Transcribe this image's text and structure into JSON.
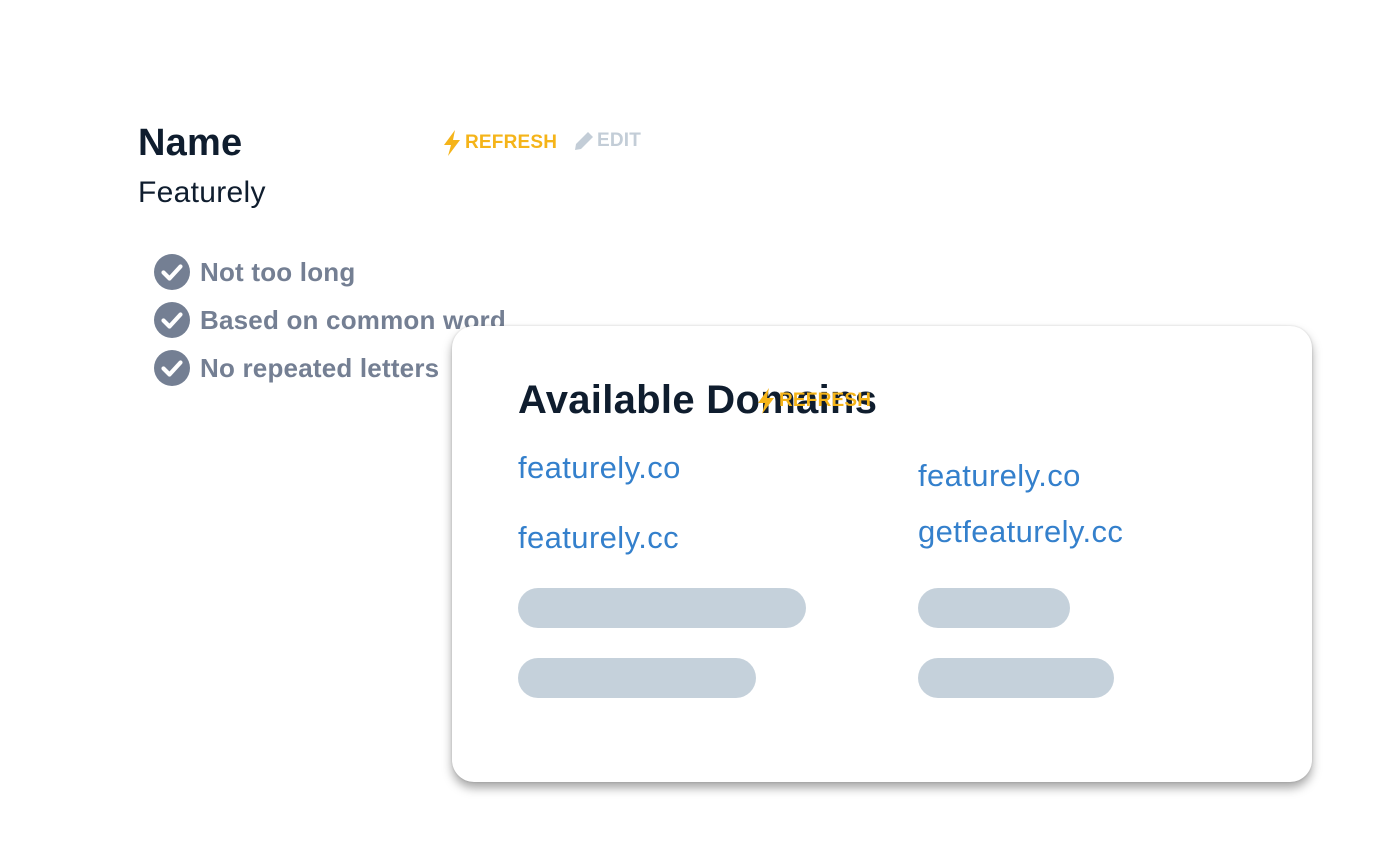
{
  "name_section": {
    "title": "Name",
    "refresh_label": "REFRESH",
    "edit_label": "EDIT",
    "value": "Featurely",
    "criteria": [
      {
        "label": "Not too long",
        "icon": "check-circle-icon"
      },
      {
        "label": "Based on common word",
        "icon": "check-circle-icon"
      },
      {
        "label": "No repeated letters",
        "icon": "check-circle-icon"
      }
    ]
  },
  "domains_card": {
    "title": "Available Domains",
    "refresh_label": "REFRESH",
    "domains": [
      "featurely.co",
      "featurely.co",
      "featurely.cc",
      "getfeaturely.cc"
    ],
    "loading_placeholders": 4
  },
  "colors": {
    "accent": "#f5b419",
    "link": "#3480cc",
    "heading": "#0f1d2e",
    "muted": "#747f93",
    "disabled": "#c3cdd7",
    "skeleton": "#c5d1db"
  }
}
